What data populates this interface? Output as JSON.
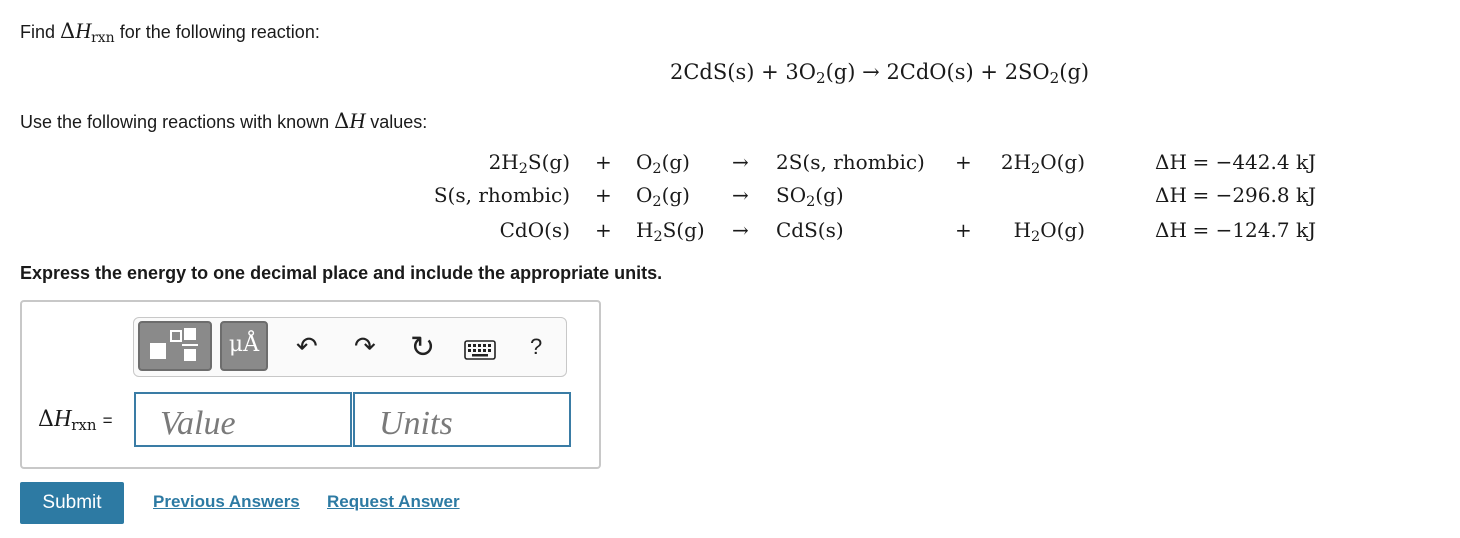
{
  "problem": {
    "find_prefix": "Find",
    "delta": "Δ",
    "H": "H",
    "rxn": "rxn",
    "find_suffix": "for the following reaction:",
    "use_prefix": "Use the following reactions with known",
    "use_suffix": "values:",
    "express": "Express the energy to one decimal place and include the appropriate units."
  },
  "main_reaction": {
    "r1": "2CdS(s)",
    "plus1": "+",
    "r2a": "3O",
    "r2sub": "2",
    "r2b": "(g)",
    "arrow": "→",
    "p1": "2CdO(s)",
    "plus2": "+",
    "p2a": "2SO",
    "p2sub": "2",
    "p2b": "(g)"
  },
  "reactions": [
    {
      "reactant1": "2H",
      "reactant1_sub": "2",
      "reactant1_tail": "S(g)",
      "plus": "+",
      "reactant2": "O",
      "reactant2_sub": "2",
      "reactant2_tail": "(g)",
      "arrow": "→",
      "product1": "2S(s, rhombic)",
      "product1_sub": "",
      "product1_tail": "",
      "plus2": "+",
      "product2": "2H",
      "product2_sub": "2",
      "product2_tail": "O(g)",
      "dh_label": "ΔH",
      "dh_value": "= −442.4 kJ"
    },
    {
      "reactant1": "S(s, rhombic)",
      "reactant1_sub": "",
      "reactant1_tail": "",
      "plus": "+",
      "reactant2": "O",
      "reactant2_sub": "2",
      "reactant2_tail": "(g)",
      "arrow": "→",
      "product1": "SO",
      "product1_sub": "2",
      "product1_tail": "(g)",
      "plus2": "",
      "product2": "",
      "product2_sub": "",
      "product2_tail": "",
      "dh_label": "ΔH",
      "dh_value": "= −296.8 kJ"
    },
    {
      "reactant1": "CdO(s)",
      "reactant1_sub": "",
      "reactant1_tail": "",
      "plus": "+",
      "reactant2": "H",
      "reactant2_sub": "2",
      "reactant2_tail": "S(g)",
      "arrow": "→",
      "product1": "CdS(s)",
      "product1_sub": "",
      "product1_tail": "",
      "plus2": "+",
      "product2": "H",
      "product2_sub": "2",
      "product2_tail": "O(g)",
      "dh_label": "ΔH",
      "dh_value": "= −124.7 kJ"
    }
  ],
  "toolbar": {
    "templates_icon": "templates-icon",
    "units_label": "μÅ",
    "undo_icon": "↶",
    "redo_icon": "↷",
    "reset_icon": "↻",
    "keyboard_icon": "keyboard-icon",
    "help_label": "?"
  },
  "answer": {
    "label_delta": "Δ",
    "label_H": "H",
    "label_sub": "rxn",
    "label_eq": "=",
    "value_placeholder": "Value",
    "units_placeholder": "Units"
  },
  "actions": {
    "submit": "Submit",
    "previous": "Previous Answers",
    "request": "Request Answer"
  },
  "colors": {
    "accent": "#2d7aa3",
    "field_border": "#3a7ca5",
    "toolbar_dark": "#8a8a8a"
  }
}
